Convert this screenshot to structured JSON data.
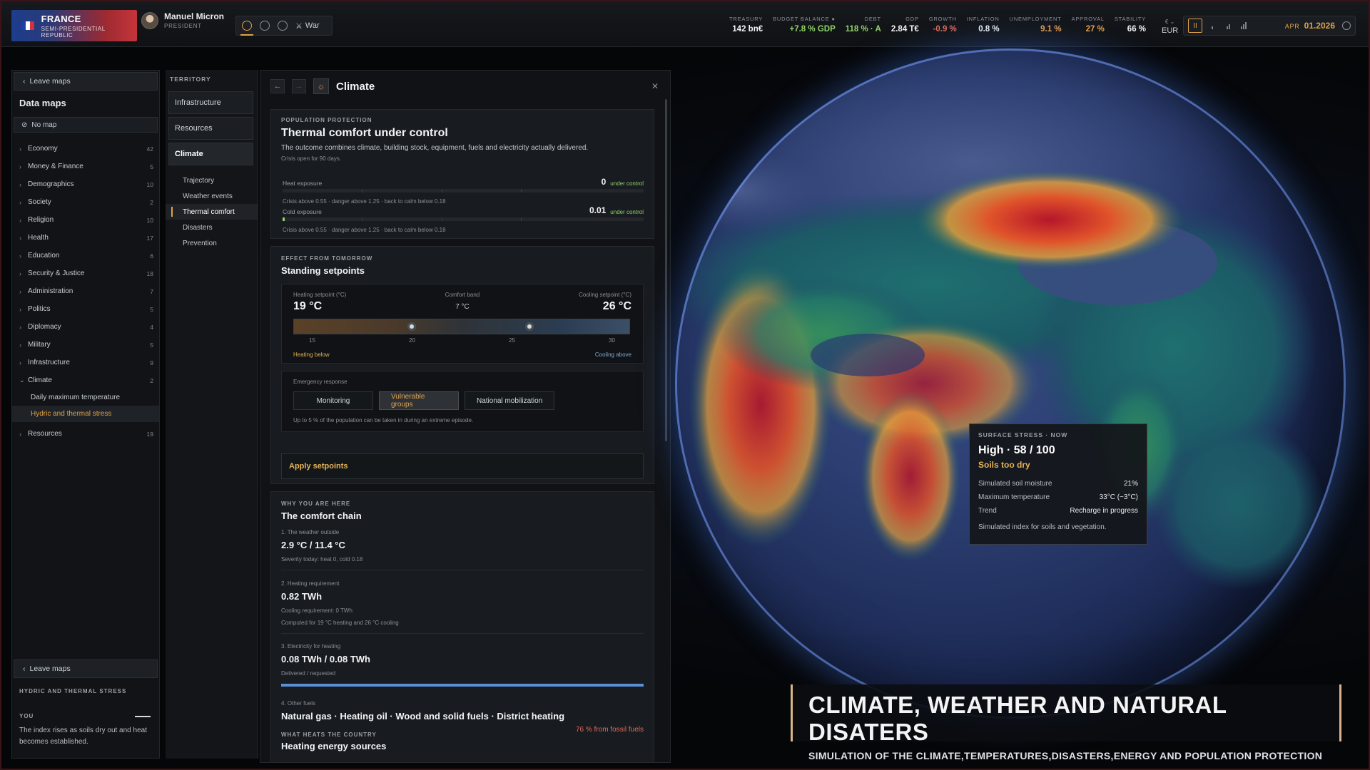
{
  "country": {
    "name": "FRANCE",
    "government": "SEMI-PRESIDENTIAL REPUBLIC",
    "flag_colors": [
      "#1f3fa8",
      "#ffffff",
      "#d6303a"
    ]
  },
  "president": {
    "name": "Manuel Micron",
    "role": "PRESIDENT"
  },
  "modes": {
    "war_label": "War",
    "icons": [
      "clock-icon",
      "globe-icon",
      "shield-icon",
      "swords-icon"
    ]
  },
  "stats": [
    {
      "label": "TREASURY",
      "value": "142 bn€",
      "color": "white"
    },
    {
      "label": "BUDGET BALANCE ●",
      "value": "+7.8 % GDP",
      "color": "green"
    },
    {
      "label": "DEBT",
      "value": "118 % · A",
      "color": "green"
    },
    {
      "label": "GDP",
      "value": "2.84 T€",
      "color": "white"
    },
    {
      "label": "GROWTH",
      "value": "-0.9 %",
      "color": "red"
    },
    {
      "label": "INFLATION",
      "value": "0.8 %",
      "color": "white"
    },
    {
      "label": "UNEMPLOYMENT",
      "value": "9.1 %",
      "color": "orange"
    },
    {
      "label": "APPROVAL",
      "value": "27 %",
      "color": "orange"
    },
    {
      "label": "STABILITY",
      "value": "66 %",
      "color": "white"
    }
  ],
  "currency": {
    "arrows": "€ ⌄",
    "code": "EUR"
  },
  "time": {
    "pause": "II",
    "month": "APR",
    "date": "01.2026"
  },
  "left_panel": {
    "leave_maps": "Leave maps",
    "title": "Data maps",
    "no_map": "No map",
    "categories": [
      {
        "label": "Economy",
        "count": "42"
      },
      {
        "label": "Money & Finance",
        "count": "5"
      },
      {
        "label": "Demographics",
        "count": "10"
      },
      {
        "label": "Society",
        "count": "2"
      },
      {
        "label": "Religion",
        "count": "10"
      },
      {
        "label": "Health",
        "count": "17"
      },
      {
        "label": "Education",
        "count": "6"
      },
      {
        "label": "Security & Justice",
        "count": "18"
      },
      {
        "label": "Administration",
        "count": "7"
      },
      {
        "label": "Politics",
        "count": "5"
      },
      {
        "label": "Diplomacy",
        "count": "4"
      },
      {
        "label": "Military",
        "count": "5"
      },
      {
        "label": "Infrastructure",
        "count": "9"
      },
      {
        "label": "Climate",
        "count": "2"
      }
    ],
    "climate_items": [
      "Daily maximum temperature",
      "Hydric and thermal stress"
    ],
    "resources": {
      "label": "Resources",
      "count": "19"
    },
    "bottom": {
      "leave_maps": "Leave maps",
      "label": "HYDRIC AND THERMAL STRESS",
      "you": "YOU",
      "desc": "The index rises as soils dry out and heat becomes established."
    }
  },
  "territory": {
    "header": "TERRITORY",
    "buttons": [
      "Infrastructure",
      "Resources",
      "Climate"
    ],
    "climate_sub": [
      "Trajectory",
      "Weather events",
      "Thermal comfort",
      "Disasters",
      "Prevention"
    ]
  },
  "panel": {
    "title": "Climate",
    "protection": {
      "label": "POPULATION PROTECTION",
      "title": "Thermal comfort under control",
      "desc": "The outcome combines climate, building stock, equipment, fuels and electricity actually delivered.",
      "crisis": "Crisis open for 90 days.",
      "heat": {
        "label": "Heat exposure",
        "value": "0",
        "status": "under control",
        "level": 0.0,
        "note": "Crisis above 0.55 · danger above 1.25 · back to calm below 0.18"
      },
      "cold": {
        "label": "Cold exposure",
        "value": "0.01",
        "status": "under control",
        "level": 0.01,
        "note": "Crisis above 0.55 · danger above 1.25 · back to calm below 0.18"
      }
    },
    "setpoints": {
      "label": "EFFECT FROM TOMORROW",
      "title": "Standing setpoints",
      "heating_label": "Heating setpoint (°C)",
      "heating_value": "19 °C",
      "comfort_label": "Comfort band",
      "comfort_value": "7 °C",
      "cooling_label": "Cooling setpoint (°C)",
      "cooling_value": "26 °C",
      "heating_setpoint": 19,
      "cooling_setpoint": 26,
      "scale_min": 12,
      "scale_max": 32,
      "ticks": [
        "15",
        "20",
        "25",
        "30"
      ],
      "heating_below": "Heating below",
      "cooling_above": "Cooling above"
    },
    "emergency": {
      "label": "Emergency response",
      "options": [
        "Monitoring",
        "Vulnerable groups",
        "National mobilization"
      ],
      "selected": "Vulnerable groups",
      "note": "Up to 5 % of the population can be taken in during an extreme episode."
    },
    "apply": "Apply setpoints",
    "chain": {
      "label": "WHY YOU ARE HERE",
      "title": "The comfort chain",
      "items": [
        {
          "head": "1. The weather outside",
          "value": "2.9 °C / 11.4 °C",
          "notes": [
            "Severity today: heat 0, cold 0.18"
          ]
        },
        {
          "head": "2. Heating requirement",
          "value": "0.82 TWh",
          "notes": [
            "Cooling requirement: 0 TWh",
            "Computed for 19 °C heating and 26 °C cooling"
          ]
        },
        {
          "head": "3. Electricity for heating",
          "value": "0.08 TWh / 0.08 TWh",
          "notes": [
            "Delivered / requested"
          ],
          "progress": 1.0
        },
        {
          "head": "4. Other fuels",
          "value": "Natural gas · Heating oil · Wood and solid fuels · District heating",
          "notes": []
        }
      ],
      "heats_label": "WHAT HEATS THE COUNTRY",
      "heats_title": "Heating energy sources",
      "fossil": "76 % from fossil fuels"
    }
  },
  "tooltip": {
    "header": "SURFACE STRESS · NOW",
    "value": "High · 58 / 100",
    "status": "Soils too dry",
    "rows": [
      {
        "k": "Simulated soil moisture",
        "v": "21%"
      },
      {
        "k": "Maximum temperature",
        "v": "33°C (−3°C)"
      },
      {
        "k": "Trend",
        "v": "Recharge in progress"
      }
    ],
    "note": "Simulated index for soils and vegetation."
  },
  "banner": {
    "title": "CLIMATE, WEATHER AND NATURAL DISATERS",
    "subtitle": "SIMULATION OF THE CLIMATE,TEMPERATURES,DISASTERS,ENERGY AND POPULATION PROTECTION"
  }
}
